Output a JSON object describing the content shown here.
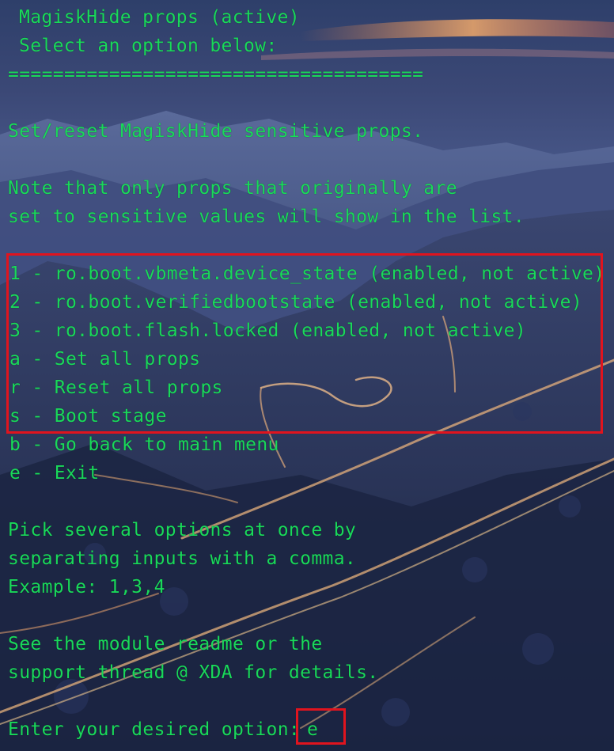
{
  "terminal": {
    "header": {
      "title": "MagiskHide props (active)",
      "subtitle": "Select an option below:",
      "separator": "====================================="
    },
    "intro": "Set/reset MagiskHide sensitive props.",
    "note": [
      "Note that only props that originally are",
      "set to sensitive values will show in the list."
    ],
    "options": [
      "1 - ro.boot.vbmeta.device_state (enabled, not active)",
      "2 - ro.boot.verifiedbootstate (enabled, not active)",
      "3 - ro.boot.flash.locked (enabled, not active)",
      "a - Set all props",
      "r - Reset all props",
      "s - Boot stage",
      "b - Go back to main menu",
      "e - Exit"
    ],
    "hint": [
      "Pick several options at once by",
      "separating inputs with a comma.",
      "Example: 1,3,4"
    ],
    "support": [
      "See the module readme or the",
      "support thread @ XDA for details."
    ],
    "prompt": {
      "label": "Enter your desired option:",
      "value": "e"
    }
  },
  "colors": {
    "text": "#19d95a",
    "highlight": "#e0141e"
  }
}
